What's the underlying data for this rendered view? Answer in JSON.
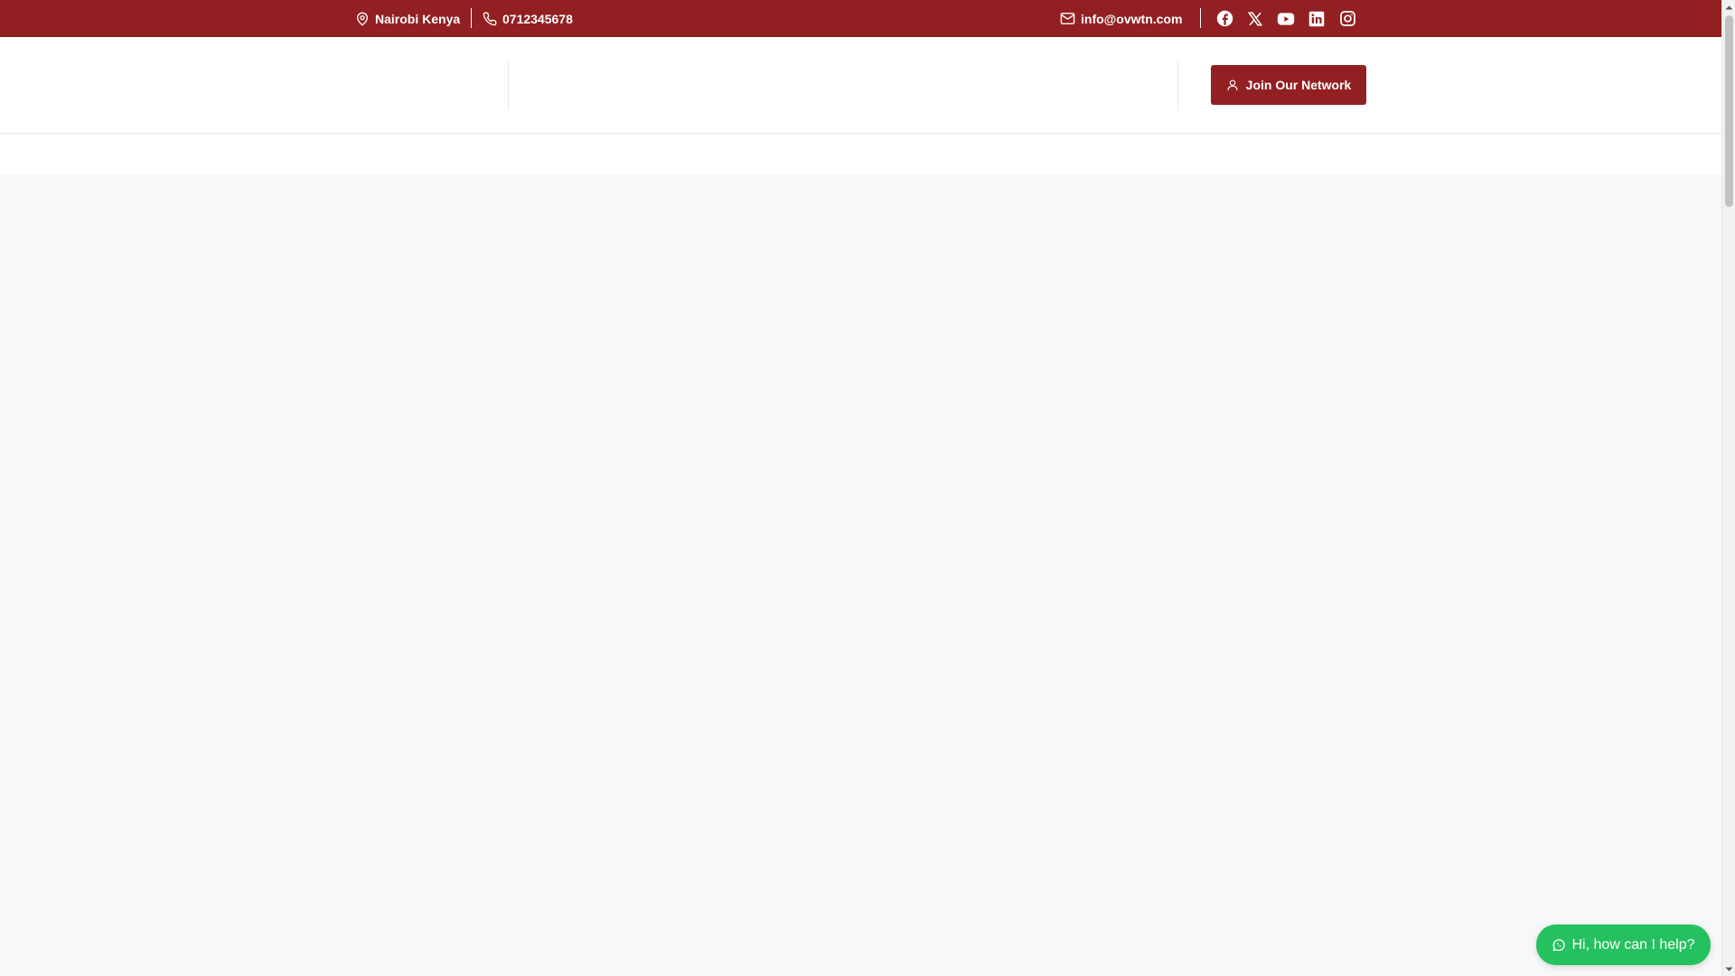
{
  "topbar": {
    "location": "Nairobi Kenya",
    "phone": "0712345678",
    "email": "info@ovwtn.com",
    "background": "#922022",
    "social": [
      "facebook-icon",
      "x-twitter-icon",
      "youtube-icon",
      "linkedin-icon",
      "instagram-icon"
    ]
  },
  "header": {
    "join_label": "Join Our Network",
    "accent": "#922022"
  },
  "whatsapp": {
    "label": "Hi, how can I help?",
    "color": "#25c15f"
  }
}
